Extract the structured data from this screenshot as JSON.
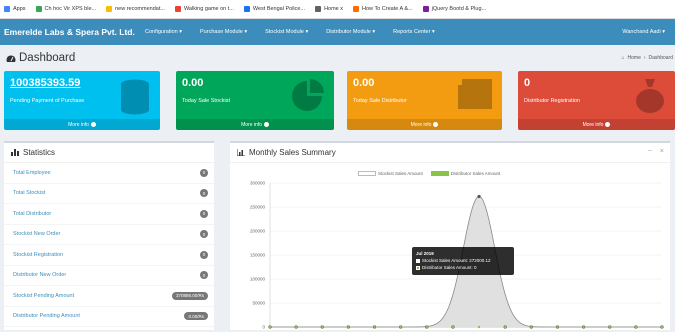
{
  "bookmarks": [
    {
      "label": "Apps",
      "color": "#4285f4"
    },
    {
      "label": "Ch hoc Vir XPS ble...",
      "color": "#34a853"
    },
    {
      "label": "new recommendat...",
      "color": "#fbbc05"
    },
    {
      "label": "Walking game on t...",
      "color": "#ea4335"
    },
    {
      "label": "West Bengal Police...",
      "color": "#1a73e8"
    },
    {
      "label": "Home x",
      "color": "#5f6368"
    },
    {
      "label": "How To Create A &...",
      "color": "#ff6d00"
    },
    {
      "label": "jQuery Bootd & Plug...",
      "color": "#7b1fa2"
    }
  ],
  "navbar": {
    "brand": "Emerelde Labs & Spera Pvt. Ltd.",
    "menu": [
      {
        "label": "Configuration ▾"
      },
      {
        "label": "Purchase Module ▾"
      },
      {
        "label": "Stockist Module ▾"
      },
      {
        "label": "Distributor Module ▾"
      },
      {
        "label": "Reports Center ▾"
      }
    ],
    "user": "Wanchand Aadi ▾"
  },
  "header": {
    "title": "Dashboard",
    "breadcrumb_home": "Home",
    "breadcrumb_current": "Dashboard"
  },
  "boxes": [
    {
      "value": "100385393.59",
      "label": "Pending Payment of Purchase",
      "more": "More info",
      "color": "#00c0ef",
      "icon": "database-icon"
    },
    {
      "value": "0.00",
      "label": "Today Sale Stockist",
      "more": "More info",
      "color": "#00a65a",
      "icon": "pie-chart-icon"
    },
    {
      "value": "0.00",
      "label": "Today Sale Distributor",
      "more": "More info",
      "color": "#f39c12",
      "icon": "newspaper-icon"
    },
    {
      "value": "0",
      "label": "Distributor Registration",
      "more": "More info",
      "color": "#dd4b39",
      "icon": "money-bag-icon"
    }
  ],
  "stats": {
    "title": "Statistics",
    "rows": [
      {
        "label": "Total Employee",
        "value": "0"
      },
      {
        "label": "Total Stockist",
        "value": "0"
      },
      {
        "label": "Total Distributor",
        "value": "0"
      },
      {
        "label": "Stockist New Order",
        "value": "0"
      },
      {
        "label": "Stockist Registration",
        "value": "0"
      },
      {
        "label": "Distributor New Order",
        "value": "0"
      },
      {
        "label": "Stockist Pending Amount",
        "value": "370886.00/Rs"
      },
      {
        "label": "Distributor Pending Amount",
        "value": "0.00/Rs"
      }
    ]
  },
  "chart_panel": {
    "title": "Monthly Sales Summary",
    "minimize": "−",
    "close": "×"
  },
  "chart_data": {
    "type": "area",
    "legend": [
      {
        "name": "Stockist Sales Amount",
        "color": "#ffffff"
      },
      {
        "name": "Distributor Sales Amount",
        "color": "#8bc34a"
      }
    ],
    "y_ticks": [
      "300000",
      "250000",
      "200000",
      "150000",
      "100000",
      "50000",
      "0"
    ],
    "ylim": [
      0,
      300000
    ],
    "series": [
      {
        "name": "Stockist Sales Amount",
        "values": [
          0,
          0,
          0,
          0,
          0,
          0,
          0,
          0,
          272000,
          0,
          0,
          0,
          0,
          0,
          0,
          0
        ]
      },
      {
        "name": "Distributor Sales Amount",
        "values": [
          0,
          0,
          0,
          0,
          0,
          0,
          0,
          0,
          0,
          0,
          0,
          0,
          0,
          0,
          0,
          0
        ]
      }
    ],
    "tooltip": {
      "title": "Jul 2019",
      "line1": "Stockist Sales Amount: 272000.12",
      "line2": "Distributor Sales Amount: 0"
    }
  }
}
